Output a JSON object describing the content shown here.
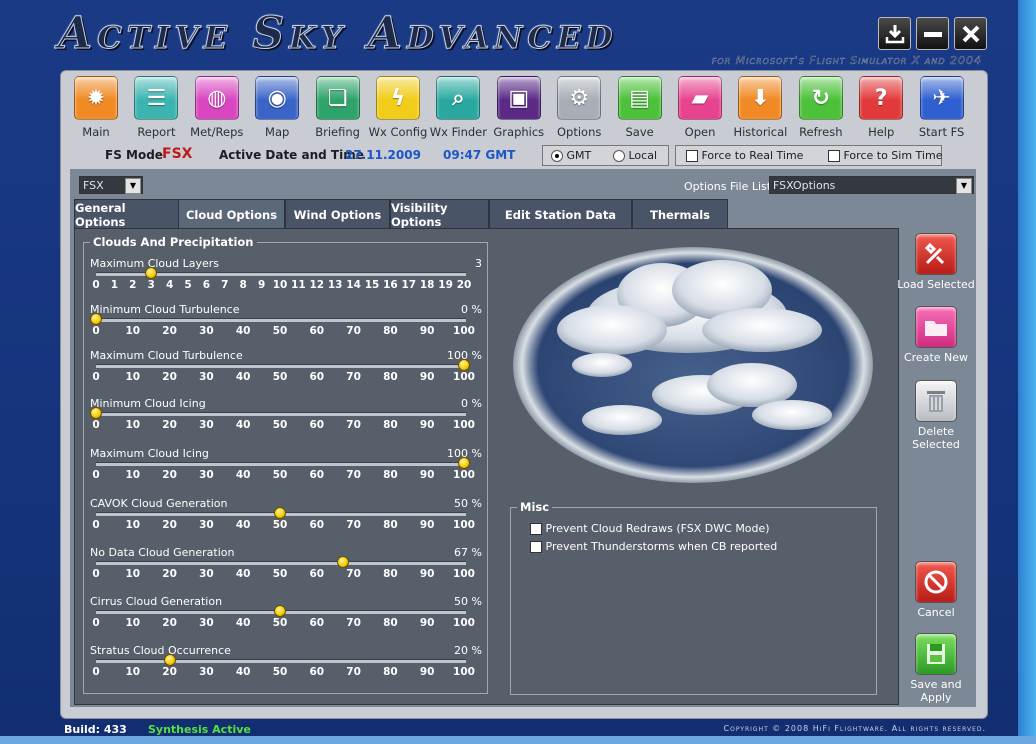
{
  "app": {
    "title": "Active Sky Advanced",
    "subtitle": "for Microsoft's Flight Simulator X and 2004"
  },
  "toolbar": [
    {
      "label": "Main",
      "icon": "sun-icon",
      "color": "#f08a24"
    },
    {
      "label": "Report",
      "icon": "report-icon",
      "color": "#3cb4b0"
    },
    {
      "label": "Met/Reps",
      "icon": "globe-icon",
      "color": "#d946c0"
    },
    {
      "label": "Map",
      "icon": "globe-map-icon",
      "color": "#3b64c8"
    },
    {
      "label": "Briefing",
      "icon": "documents-icon",
      "color": "#2ea36a"
    },
    {
      "label": "Wx Config",
      "icon": "lightning-icon",
      "color": "#f2cc1a"
    },
    {
      "label": "Wx Finder",
      "icon": "magnifier-icon",
      "color": "#2aa8a0"
    },
    {
      "label": "Graphics",
      "icon": "graphics-icon",
      "color": "#5a2a86"
    },
    {
      "label": "Options",
      "icon": "gears-icon",
      "color": "#a8adb6"
    },
    {
      "label": "Save",
      "icon": "floppy-icon",
      "color": "#4cc13a"
    },
    {
      "label": "Open",
      "icon": "open-folder-icon",
      "color": "#e8438e"
    },
    {
      "label": "Historical",
      "icon": "download-arrow-icon",
      "color": "#f08a24"
    },
    {
      "label": "Refresh",
      "icon": "refresh-icon",
      "color": "#4cc13a"
    },
    {
      "label": "Help",
      "icon": "question-icon",
      "color": "#e23a3a"
    },
    {
      "label": "Start FS",
      "icon": "airplane-icon",
      "color": "#2f5fd0"
    }
  ],
  "status": {
    "fs_mode_label": "FS Mode",
    "fs_mode_value": "FSX",
    "date_label": "Active Date and Time",
    "date": "27.11.2009",
    "time": "09:47 GMT",
    "gmt": "GMT",
    "local": "Local",
    "force_real": "Force to Real Time",
    "force_sim": "Force to Sim Time"
  },
  "selectors": {
    "fs_select": "FSX",
    "options_file_label": "Options File List",
    "options_file_value": "FSXOptions"
  },
  "tabs": [
    "General Options",
    "Cloud Options",
    "Wind Options",
    "Visibility Options",
    "Edit Station Data",
    "Thermals"
  ],
  "clouds": {
    "legend": "Clouds And Precipitation",
    "sliders": [
      {
        "name": "Maximum Cloud Layers",
        "value_text": "3",
        "value": 3,
        "max": 20,
        "ticks": [
          "0",
          "1",
          "2",
          "3",
          "4",
          "5",
          "6",
          "7",
          "8",
          "9",
          "10",
          "11",
          "12",
          "13",
          "14",
          "15",
          "16",
          "17",
          "18",
          "19",
          "20"
        ]
      },
      {
        "name": "Minimum Cloud Turbulence",
        "value_text": "0 %",
        "value": 0,
        "max": 100,
        "ticks": [
          "0",
          "10",
          "20",
          "30",
          "40",
          "50",
          "60",
          "70",
          "80",
          "90",
          "100"
        ]
      },
      {
        "name": "Maximum Cloud Turbulence",
        "value_text": "100 %",
        "value": 100,
        "max": 100,
        "ticks": [
          "0",
          "10",
          "20",
          "30",
          "40",
          "50",
          "60",
          "70",
          "80",
          "90",
          "100"
        ]
      },
      {
        "name": "Minimum Cloud Icing",
        "value_text": "0 %",
        "value": 0,
        "max": 100,
        "ticks": [
          "0",
          "10",
          "20",
          "30",
          "40",
          "50",
          "60",
          "70",
          "80",
          "90",
          "100"
        ]
      },
      {
        "name": "Maximum Cloud Icing",
        "value_text": "100 %",
        "value": 100,
        "max": 100,
        "ticks": [
          "0",
          "10",
          "20",
          "30",
          "40",
          "50",
          "60",
          "70",
          "80",
          "90",
          "100"
        ]
      },
      {
        "name": "CAVOK Cloud Generation",
        "value_text": "50 %",
        "value": 50,
        "max": 100,
        "ticks": [
          "0",
          "10",
          "20",
          "30",
          "40",
          "50",
          "60",
          "70",
          "80",
          "90",
          "100"
        ]
      },
      {
        "name": "No Data Cloud Generation",
        "value_text": "67 %",
        "value": 67,
        "max": 100,
        "ticks": [
          "0",
          "10",
          "20",
          "30",
          "40",
          "50",
          "60",
          "70",
          "80",
          "90",
          "100"
        ]
      },
      {
        "name": "Cirrus Cloud Generation",
        "value_text": "50 %",
        "value": 50,
        "max": 100,
        "ticks": [
          "0",
          "10",
          "20",
          "30",
          "40",
          "50",
          "60",
          "70",
          "80",
          "90",
          "100"
        ]
      },
      {
        "name": "Stratus Cloud Occurrence",
        "value_text": "20 %",
        "value": 20,
        "max": 100,
        "ticks": [
          "0",
          "10",
          "20",
          "30",
          "40",
          "50",
          "60",
          "70",
          "80",
          "90",
          "100"
        ]
      }
    ]
  },
  "misc": {
    "legend": "Misc",
    "opt1": "Prevent Cloud Redraws (FSX DWC Mode)",
    "opt2": "Prevent Thunderstorms when CB reported"
  },
  "side_buttons": {
    "load": "Load Selected",
    "create": "Create New",
    "delete": "Delete Selected",
    "cancel": "Cancel",
    "save_apply": "Save and Apply"
  },
  "footer": {
    "build": "Build: 433",
    "synthesis": "Synthesis Active",
    "copyright": "Copyright © 2008 HiFi Flightware. All rights reserved."
  },
  "colors": {
    "fs_mode": "#c01818",
    "date_time": "#1b56c8",
    "synthesis": "#55e040",
    "slider_thumb": "#f5c800"
  }
}
